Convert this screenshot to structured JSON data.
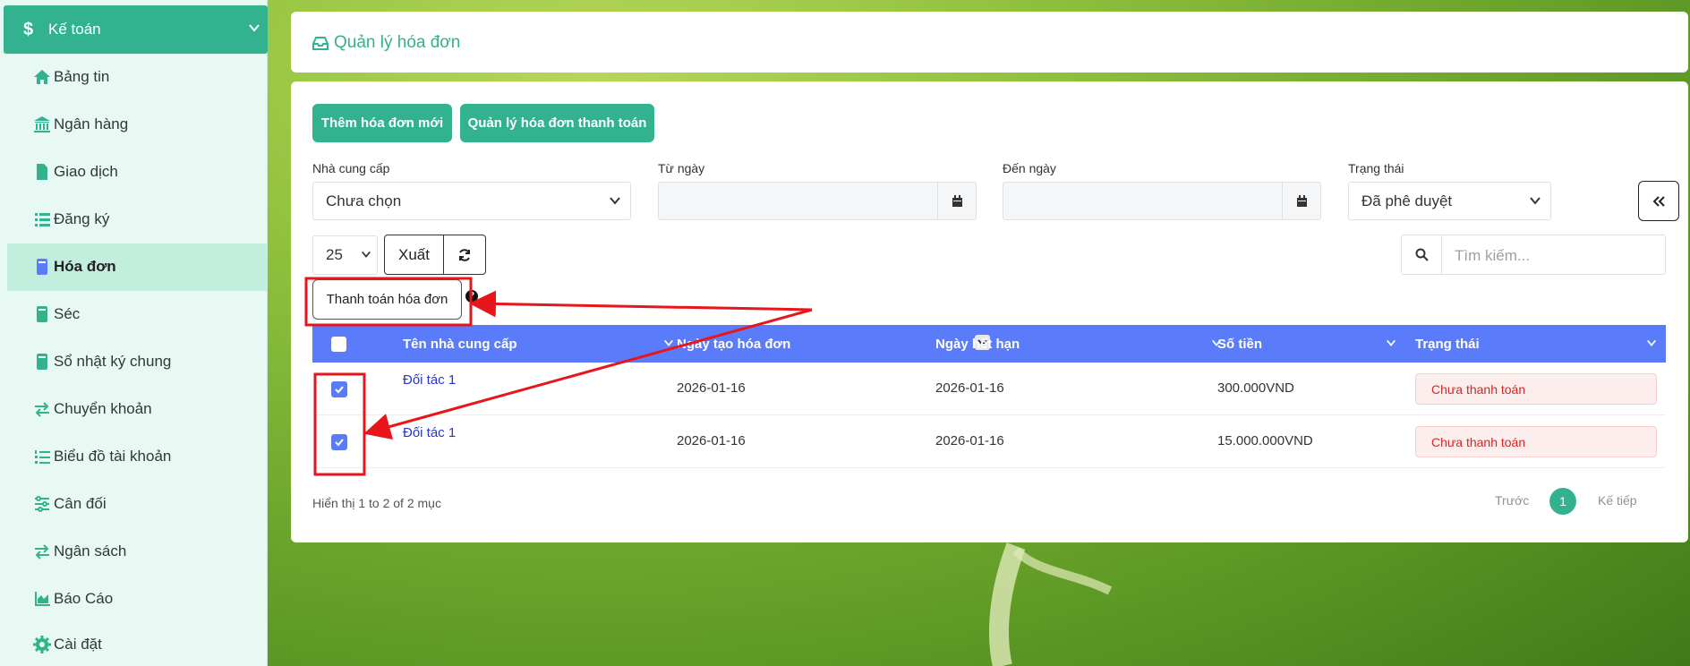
{
  "sidebar": {
    "header": "Kế toán",
    "items": [
      {
        "label": "Bảng tin",
        "icon": "home-icon"
      },
      {
        "label": "Ngân hàng",
        "icon": "bank-icon"
      },
      {
        "label": "Giao dịch",
        "icon": "file-icon"
      },
      {
        "label": "Đăng ký",
        "icon": "list-icon"
      },
      {
        "label": "Hóa đơn",
        "icon": "book-icon",
        "active": true
      },
      {
        "label": "Séc",
        "icon": "book-icon"
      },
      {
        "label": "Sổ nhật ký chung",
        "icon": "book-icon"
      },
      {
        "label": "Chuyển khoản",
        "icon": "exchange-icon"
      },
      {
        "label": "Biểu đồ tài khoản",
        "icon": "list-ol-icon"
      },
      {
        "label": "Cân đối",
        "icon": "sliders-icon"
      },
      {
        "label": "Ngân sách",
        "icon": "exchange-icon"
      },
      {
        "label": "Báo Cáo",
        "icon": "area-chart-icon"
      },
      {
        "label": "Cài đặt",
        "icon": "gear-icon"
      }
    ]
  },
  "page": {
    "title": "Quản lý hóa đơn"
  },
  "toolbar": {
    "add_label": "Thêm hóa đơn mới",
    "manage_label": "Quản lý hóa đơn thanh toán"
  },
  "filters": {
    "supplier_label": "Nhà cung cấp",
    "supplier_value": "Chưa chọn",
    "from_label": "Từ ngày",
    "to_label": "Đến ngày",
    "status_label": "Trạng thái",
    "status_value": "Đã phê duyệt"
  },
  "controls": {
    "page_size": "25",
    "export_label": "Xuất",
    "search_placeholder": "Tìm kiếm...",
    "pay_label": "Thanh toán hóa đơn"
  },
  "table": {
    "columns": [
      "Tên nhà cung cấp",
      "Ngày tạo hóa đơn",
      "Ngày hết hạn",
      "Số tiền",
      "Trạng thái"
    ],
    "rows": [
      {
        "supplier": "Đối tác 1",
        "created": "2026-01-16",
        "due": "2026-01-16",
        "amount": "300.000VND",
        "status": "Chưa thanh toán",
        "checked": true
      },
      {
        "supplier": "Đối tác 1",
        "created": "2026-01-16",
        "due": "2026-01-16",
        "amount": "15.000.000VND",
        "status": "Chưa thanh toán",
        "checked": true
      }
    ]
  },
  "footer": {
    "info": "Hiển thị 1 to 2 of 2 mục",
    "prev": "Trước",
    "current": "1",
    "next": "Kế tiếp"
  },
  "colors": {
    "accent": "#33b28f",
    "table_header": "#5b7cfa",
    "status_danger": "#d52626",
    "annotation": "#e8161b"
  }
}
